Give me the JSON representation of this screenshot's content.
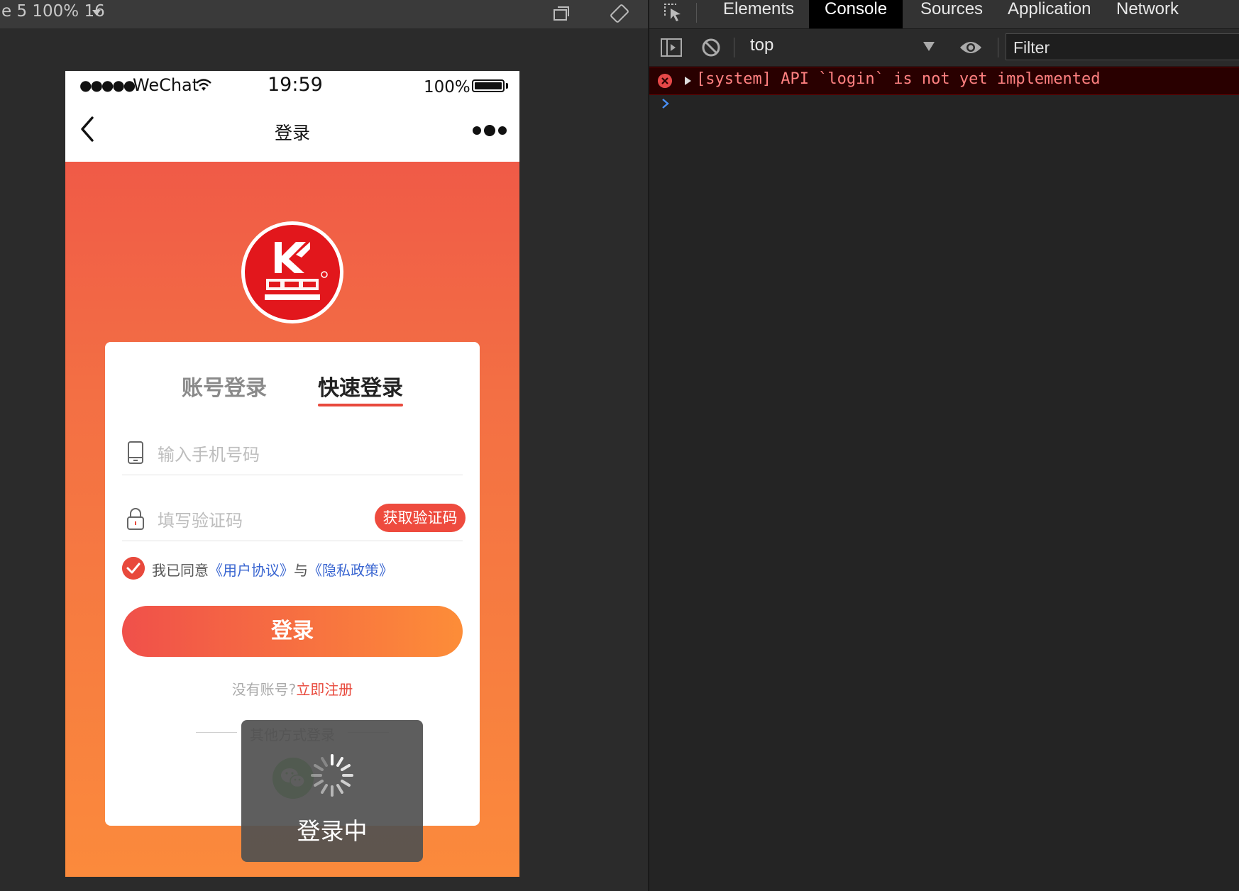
{
  "simulator": {
    "device_label": "e 5 100% 16"
  },
  "phone": {
    "statusbar": {
      "signal": "●●●●●",
      "carrier": "WeChat",
      "time": "19:59",
      "battery_pct": "100%"
    },
    "navbar": {
      "title": "登录"
    },
    "tabs": [
      {
        "label": "账号登录",
        "active": false
      },
      {
        "label": "快速登录",
        "active": true
      }
    ],
    "form": {
      "phone_placeholder": "输入手机号码",
      "code_placeholder": "填写验证码",
      "get_code_label": "获取验证码",
      "agree_prefix": "我已同意",
      "user_agreement": "《用户协议》",
      "agree_and": "与",
      "privacy_policy": "《隐私政策》",
      "login_label": "登录",
      "no_account": "没有账号?",
      "register_link": "立即注册",
      "other_login": "其他方式登录"
    },
    "toast": {
      "text": "登录中"
    }
  },
  "devtools": {
    "tabs": [
      {
        "label": "Elements",
        "active": false
      },
      {
        "label": "Console",
        "active": true
      },
      {
        "label": "Sources",
        "active": false
      },
      {
        "label": "Application",
        "active": false
      },
      {
        "label": "Network",
        "active": false
      }
    ],
    "context": "top",
    "filter_placeholder": "Filter",
    "console": {
      "error_message": "[system] API `login` is not yet implemented"
    }
  },
  "colors": {
    "accent_red": "#e8493c",
    "gradient_top": "#ef5248",
    "gradient_bottom": "#fb8a3c",
    "wechat_green": "#5ac454",
    "error_text": "#ff8080"
  }
}
